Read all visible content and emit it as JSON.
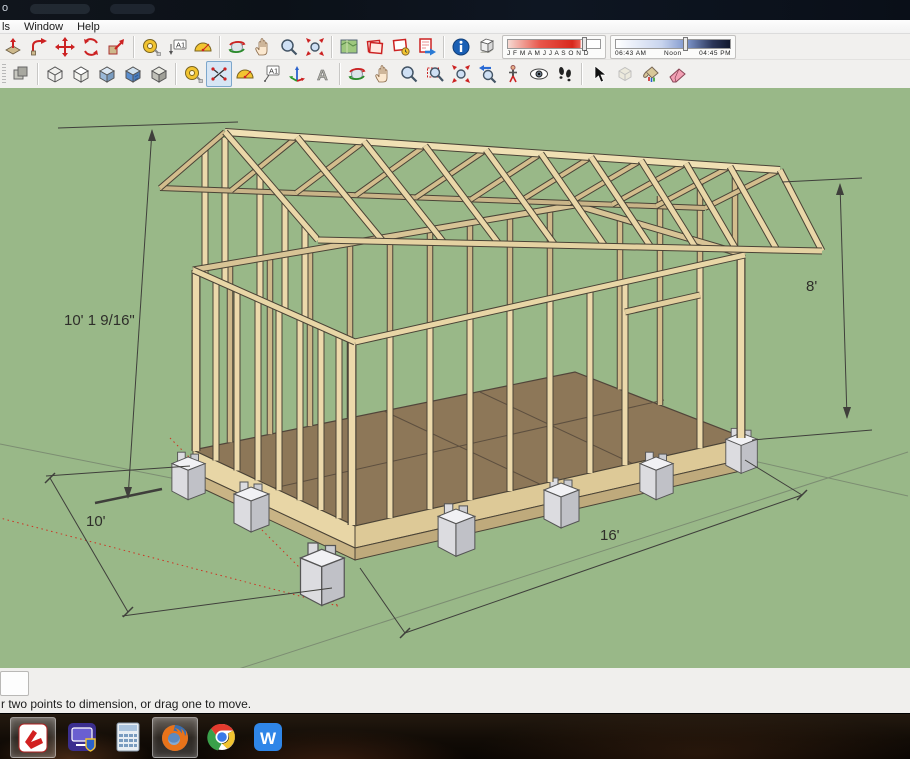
{
  "window": {
    "title_fragment": "o"
  },
  "menu": {
    "items": [
      {
        "label": "ls"
      },
      {
        "label": "Window"
      },
      {
        "label": "Help"
      }
    ]
  },
  "icons": {
    "text_tool_label": "A1",
    "text3d_label": "A",
    "w_app_label": "W"
  },
  "shadow_controls": {
    "months": "J F M A M J J A S O N D",
    "time_start": "06:43 AM",
    "time_mid": "Noon",
    "time_end": "04:45 PM"
  },
  "canvas": {
    "dim_height": "10' 1 9/16\"",
    "dim_wall_height": "8'",
    "dim_width": "10'",
    "dim_length": "16'",
    "colors": {
      "background": "#99b888",
      "wood_light": "#ead7a8",
      "wood_dark": "#4a4336",
      "floor": "#8d7758",
      "block": "#eeeef1"
    }
  },
  "status": {
    "message": "r two points to dimension, or drag one to move."
  }
}
